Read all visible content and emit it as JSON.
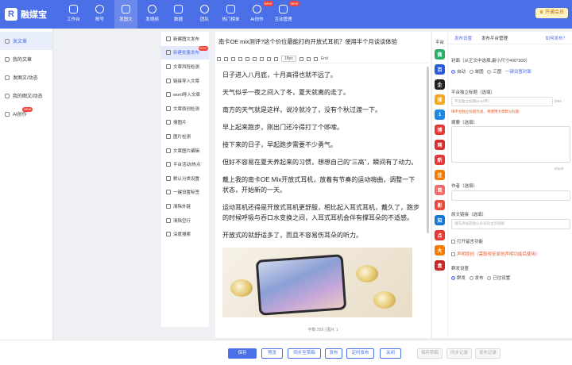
{
  "app": {
    "brand": "融媒宝",
    "vip_label": "开通会员"
  },
  "nav": [
    {
      "label": "工作台"
    },
    {
      "label": "账号"
    },
    {
      "label": "发图文"
    },
    {
      "label": "发视频"
    },
    {
      "label": "数据"
    },
    {
      "label": "团队"
    },
    {
      "label": "热门榜单"
    },
    {
      "label": "AI创作",
      "badge": "NEW"
    },
    {
      "label": "互动管理",
      "badge": "NEW"
    }
  ],
  "sidebar": [
    {
      "label": "发文章"
    },
    {
      "label": "我的文章"
    },
    {
      "label": "发图文/动态"
    },
    {
      "label": "我的图文/动态"
    },
    {
      "label": "AI创作",
      "badge": "NEW"
    }
  ],
  "tools": [
    {
      "label": "新建图文发布"
    },
    {
      "label": "新建批量发布",
      "badge": "HOT"
    },
    {
      "label": "文章风险检测"
    },
    {
      "label": "链接导入文章"
    },
    {
      "label": "word导入文章"
    },
    {
      "label": "文章原创检测"
    },
    {
      "label": "搜图片"
    },
    {
      "label": "图片检测"
    },
    {
      "label": "文章图片编辑"
    },
    {
      "label": "平台活动/热点"
    },
    {
      "label": "默认分类设置"
    },
    {
      "label": "一键设置标签"
    },
    {
      "label": "清除外链"
    },
    {
      "label": "清除空行"
    },
    {
      "label": "深度搜索"
    }
  ],
  "editor": {
    "title": "南卡OE mix测评?这个价位最能打的开放式耳机？使用半个月谈谈体验",
    "toolbar_font": "18px",
    "toolbar_tail": "End",
    "paragraphs": [
      "日子进入八月底，十月高得也就不远了。",
      "天气似乎一夜之间入了冬，夏天就离的走了。",
      "南方的天气就是这样，说冷就冷了，没有个秋过渡一下。",
      "早上起来跑步，刚出门还冷得打了个哆嗦。",
      "接下来的日子，早起跑步需要不少勇气。",
      "但好不容易在夏天养起来的习惯，想想自己的“三高”，瞬间有了动力。",
      "戴上我的南卡OE Mix开放式耳机，放着有节奏的运动嗨曲，调整一下状态，开始新的一天。",
      "运动耳机还得是开放式耳机更舒服，相比起入耳式耳机，戴久了，跑步的时候呼吸与吞口水变换之间，入耳式耳机会伴有撑耳朵的不适感。",
      "开放式的就舒适多了，而且不容易伤耳朵的听力。"
    ],
    "status": "字数 259  |  图片 1"
  },
  "platforms": {
    "header": "平台",
    "items": [
      {
        "icon": "wechat-icon",
        "text": "微",
        "color": "#2aae67"
      },
      {
        "icon": "baidu-icon",
        "text": "百",
        "color": "#2a5bd7"
      },
      {
        "icon": "penguin-icon",
        "text": "企",
        "color": "#222222"
      },
      {
        "icon": "sohu-icon",
        "text": "搜",
        "color": "#f5a623"
      },
      {
        "icon": "toutiao-icon",
        "text": "1",
        "color": "#1e88e5"
      },
      {
        "icon": "weibo-icon",
        "text": "博",
        "color": "#e53935"
      },
      {
        "icon": "wangyi-icon",
        "text": "网",
        "color": "#d32f2f"
      },
      {
        "icon": "sina-icon",
        "text": "新",
        "color": "#e53935"
      },
      {
        "icon": "douban-icon",
        "text": "豆",
        "color": "#f57c00"
      },
      {
        "icon": "jian-icon",
        "text": "简",
        "color": "#ef6c6c"
      },
      {
        "icon": "video-icon",
        "text": "影",
        "color": "#e94b3c"
      },
      {
        "icon": "zhihu-icon",
        "text": "知",
        "color": "#1976d2"
      },
      {
        "icon": "yidian-icon",
        "text": "点",
        "color": "#e53935"
      },
      {
        "icon": "dayu-icon",
        "text": "大",
        "color": "#f57c00"
      },
      {
        "icon": "box-icon",
        "text": "盒",
        "color": "#c62828"
      }
    ]
  },
  "settings": {
    "tabs": [
      "发布设置",
      "发布平台管理"
    ],
    "help": "如何发布？",
    "cover_label": "封面（从正文中选择,最小尺寸400*300）",
    "cover_options": [
      "自动",
      "单图",
      "三图"
    ],
    "cover_link": "一键设置封面",
    "title_label": "平台独立标题（选填）",
    "title_placeholder": "平台独立标题(5-64字)",
    "title_count": "0/64",
    "title_warn": "填平台独立标题为发，将使用文章默认标题",
    "summary_label": "摘要（选填）",
    "summary_count": "0/120",
    "author_label": "作者（选填）",
    "source_label": "原文链接（选填）",
    "source_placeholder": "请先添加其他公众号的主页链接",
    "open_comment": "打开留言功能",
    "declare_label": "声明原创（需取得至原创声明功能后使用）",
    "publish_label": "群发设置",
    "publish_options": [
      "群发",
      "发布",
      "已往设置"
    ]
  },
  "footer": {
    "buttons": [
      "保存",
      "预览",
      "同步至草稿",
      "发布",
      "定时发布",
      "关闭"
    ],
    "disabled": [
      "保存草稿",
      "同步记录",
      "发布记录"
    ]
  }
}
